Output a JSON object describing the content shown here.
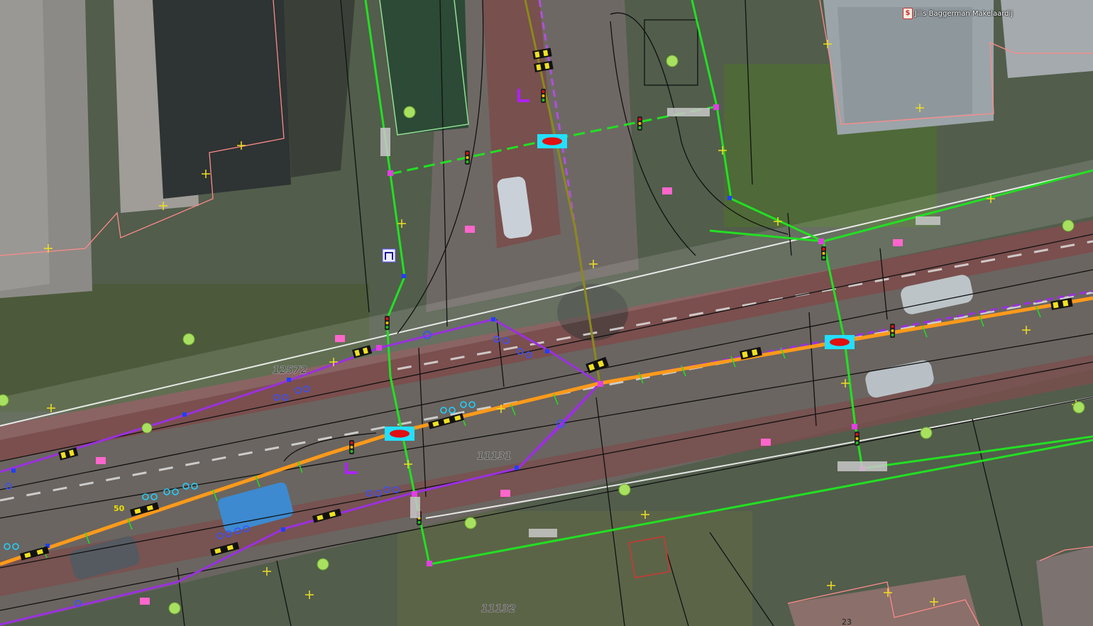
{
  "map": {
    "poi": {
      "label": "Jilis Baggerman Makelaardij",
      "icon": "real-estate-icon"
    },
    "road_ids": [
      "12572",
      "11131",
      "11132"
    ],
    "house_number": "23",
    "speed_limit": "50",
    "colors": {
      "road_centerline": "#ff9a1a",
      "bike_path": "#9b30e0",
      "footpath": "#22e022",
      "parcel_boundary": "#ff8080",
      "crossing_marker": "#22e0ff",
      "junction_node": "#e040e0",
      "vertex": "#f0e020"
    }
  }
}
